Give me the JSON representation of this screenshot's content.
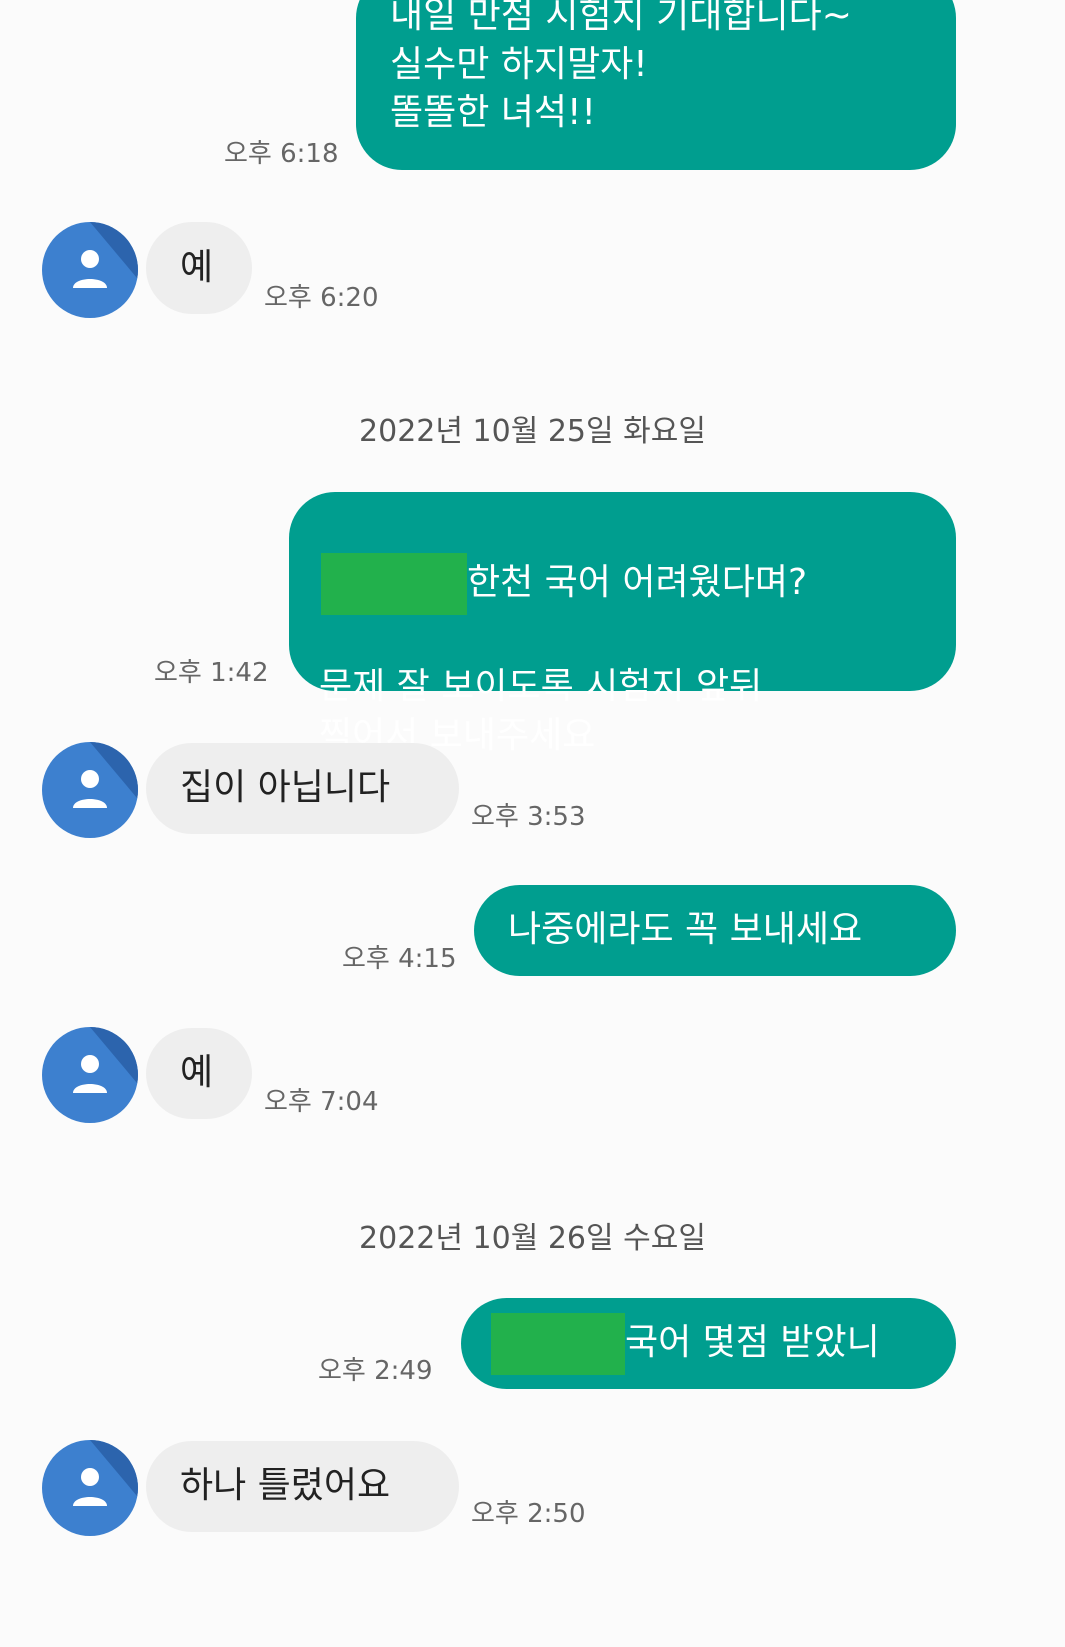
{
  "messages": [
    {
      "type": "sent",
      "lines": "내일 만점 시험지 기대합니다~\n실수만 하지말자!\n똘똘한 녀석!!",
      "time": "오후 6:18"
    },
    {
      "type": "received",
      "text": "예",
      "time": "오후 6:20"
    },
    {
      "type": "date",
      "text": "2022년 10월 25일 화요일"
    },
    {
      "type": "sent",
      "lines_after_redaction": "한천 국어 어려웠다며?",
      "lines_rest": "문제 잘 보이도록 시험지 앞뒤\n찍어서 보내주세요",
      "time": "오후 1:42"
    },
    {
      "type": "received",
      "text": "집이 아닙니다",
      "time": "오후 3:53"
    },
    {
      "type": "sent",
      "text": "나중에라도 꼭 보내세요",
      "time": "오후 4:15"
    },
    {
      "type": "received",
      "text": "예",
      "time": "오후 7:04"
    },
    {
      "type": "date",
      "text": "2022년 10월 26일 수요일"
    },
    {
      "type": "sent",
      "text_after_redaction": "국어 몇점 받았니",
      "time": "오후 2:49"
    },
    {
      "type": "received",
      "text": "하나 틀렸어요",
      "time": "오후 2:50"
    }
  ],
  "icons": {
    "avatar": "person-icon"
  },
  "colors": {
    "sent_bubble": "#009e8f",
    "received_bubble": "#eeeeee",
    "avatar": "#3d80cf",
    "redaction": "#22b14c",
    "background": "#fbfbfb"
  }
}
